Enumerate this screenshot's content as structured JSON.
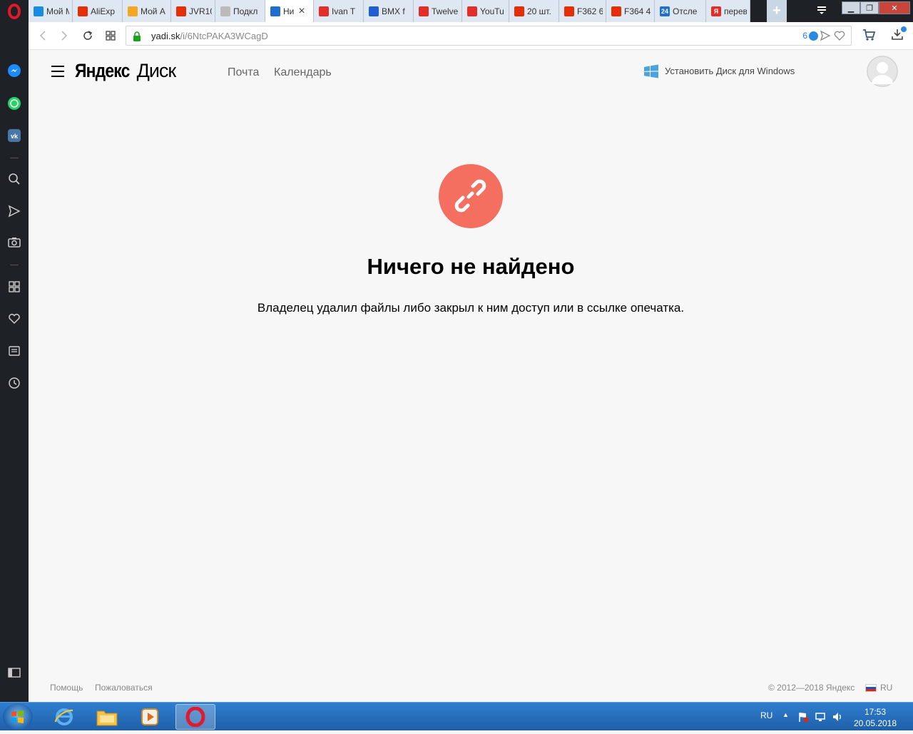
{
  "browser": {
    "tabs": [
      {
        "label": "Мой М",
        "icon": "mail-ru-icon",
        "color": "#168de2"
      },
      {
        "label": "AliExp",
        "icon": "aliexpress-icon",
        "color": "#e62e04"
      },
      {
        "label": "Мой А",
        "icon": "aliexpress-icon",
        "color": "#f5a623"
      },
      {
        "label": "JVR10",
        "icon": "aliexpress-icon",
        "color": "#e62e04"
      },
      {
        "label": "Подкл",
        "icon": "loading-icon",
        "color": "#bbbbbb"
      },
      {
        "label": "Ни",
        "icon": "yandex-disk-icon",
        "color": "#1f6fd1",
        "active": true
      },
      {
        "label": "Ivan T",
        "icon": "youtube-icon",
        "color": "#e52d27"
      },
      {
        "label": "BMX f",
        "icon": "bmx-icon",
        "color": "#1f5fd1"
      },
      {
        "label": "Twelve",
        "icon": "youtube-icon",
        "color": "#e52d27"
      },
      {
        "label": "YouTu",
        "icon": "youtube-icon",
        "color": "#e52d27"
      },
      {
        "label": "20 шт.",
        "icon": "aliexpress-icon",
        "color": "#e62e04"
      },
      {
        "label": "F362 6",
        "icon": "aliexpress-icon",
        "color": "#e62e04"
      },
      {
        "label": "F364 4",
        "icon": "aliexpress-icon",
        "color": "#e62e04"
      },
      {
        "label": "Отсле",
        "icon": "tracking-24-icon",
        "color": "#1f6fd1",
        "badge": "24"
      },
      {
        "label": "перев",
        "icon": "yandex-icon",
        "color": "#e52d27",
        "badge": "Я"
      }
    ],
    "url": {
      "host": "yadi.sk",
      "path": "/i/6NtcPAKA3WCagD"
    },
    "extension_count": "6"
  },
  "page": {
    "logo": {
      "yandex": "Яндекс",
      "disk": "Диск"
    },
    "nav": {
      "mail": "Почта",
      "calendar": "Календарь"
    },
    "install_link": "Установить Диск для Windows",
    "empty_state": {
      "title": "Ничего не найдено",
      "description": "Владелец удалил файлы либо закрыл к ним доступ или в ссылке опечатка."
    },
    "footer": {
      "help": "Помощь",
      "report": "Пожаловаться",
      "copyright": "© 2012—2018 Яндекс",
      "lang": "RU"
    }
  },
  "taskbar": {
    "lang": "RU",
    "time": "17:53",
    "date": "20.05.2018"
  },
  "colors": {
    "accent_error": "#f46f5f",
    "sidebar": "#1e2227",
    "taskbar": "#2f7fd0"
  }
}
